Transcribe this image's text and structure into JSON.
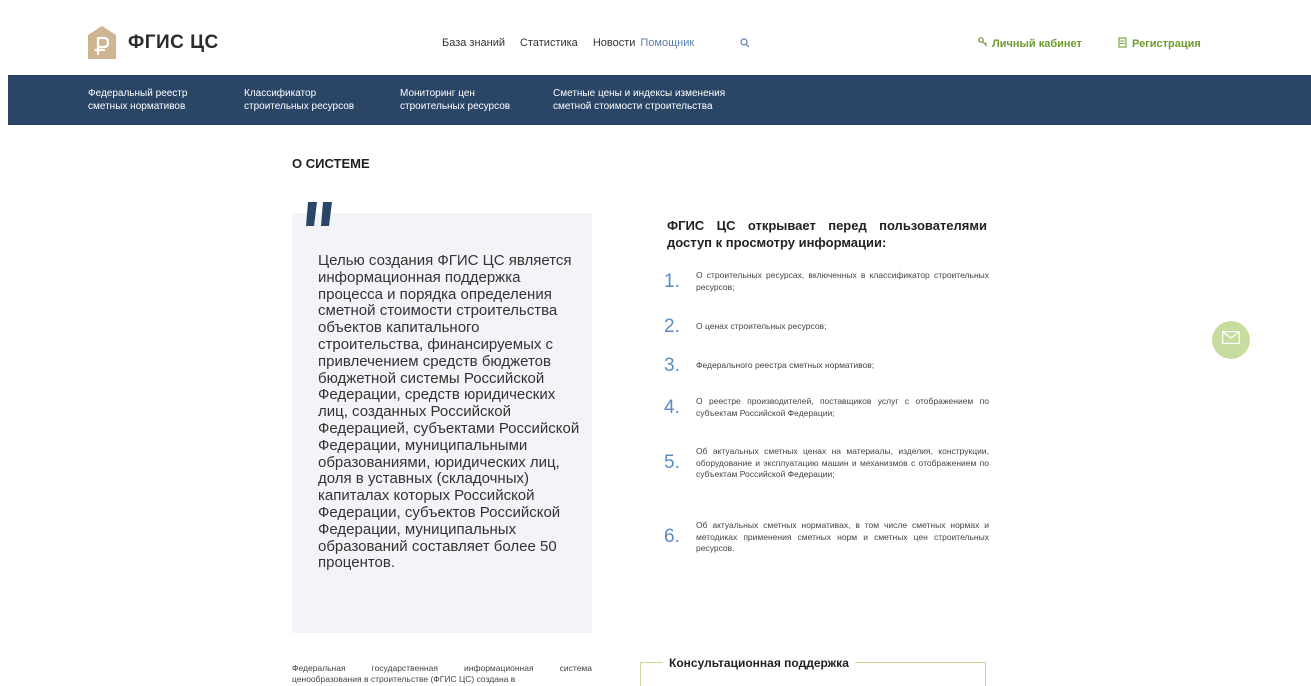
{
  "header": {
    "logo_text": "ФГИС ЦС",
    "nav": [
      "База знаний",
      "Статистика",
      "Новости"
    ],
    "nav_muted": "Помощник",
    "account_label": "Личный кабинет",
    "register_label": "Регистрация"
  },
  "mainnav": {
    "items": [
      {
        "line1": "Федеральный реестр",
        "line2": "сметных нормативов"
      },
      {
        "line1": "Классификатор",
        "line2": "строительных ресурсов"
      },
      {
        "line1": "Мониторинг цен",
        "line2": "строительных ресурсов"
      },
      {
        "line1": "Сметные цены и индексы изменения",
        "line2": "сметной стоимости строительства"
      }
    ]
  },
  "content": {
    "section_title": "О СИСТЕМЕ",
    "quote": "Целью создания ФГИС ЦС является информационная поддержка процесса и порядка определения сметной стоимости строительства объектов капитального строительства, финансируемых с привлечением средств бюджетов бюджетной системы Российской Федерации, средств юридических лиц, созданных Российской Федерацией, субъектами Российской Федерации, муниципальными образованиями, юридических лиц, доля в уставных (складочных) капиталах которых Российской Федерации, субъектов Российской Федерации, муниципальных образований составляет более 50 процентов.",
    "bottom_text": "Федеральная государственная информационная система ценообразования в строительстве (ФГИС ЦС) создана в",
    "right_title": "ФГИС ЦС открывает перед пользователями доступ к просмотру информации:",
    "list": [
      {
        "num": "1.",
        "text": "О строительных ресурсах, включенных в классификатор строительных ресурсов;"
      },
      {
        "num": "2.",
        "text": "О ценах строительных ресурсов;"
      },
      {
        "num": "3.",
        "text": "Федерального реестра сметных нормативов;"
      },
      {
        "num": "4.",
        "text": "О реестре производителей, поставщиков услуг с отображением по субъектам Российской Федерации;"
      },
      {
        "num": "5.",
        "text": "Об актуальных сметных ценах на материалы, изделия, конструкции, оборудование и эксплуатацию машин и механизмов с отображением по субъектам Российской Федерации;"
      },
      {
        "num": "6.",
        "text": "Об актуальных сметных нормативах, в том числе сметных нормах и методиках применения сметных норм и сметных цен строительных ресурсов."
      }
    ],
    "consult_title": "Консультационная поддержка"
  },
  "colors": {
    "navbar": "#2a4566",
    "accent_green": "#6d9a2e",
    "number_blue": "#5b8bc5",
    "logo_tan": "#cdb591"
  }
}
